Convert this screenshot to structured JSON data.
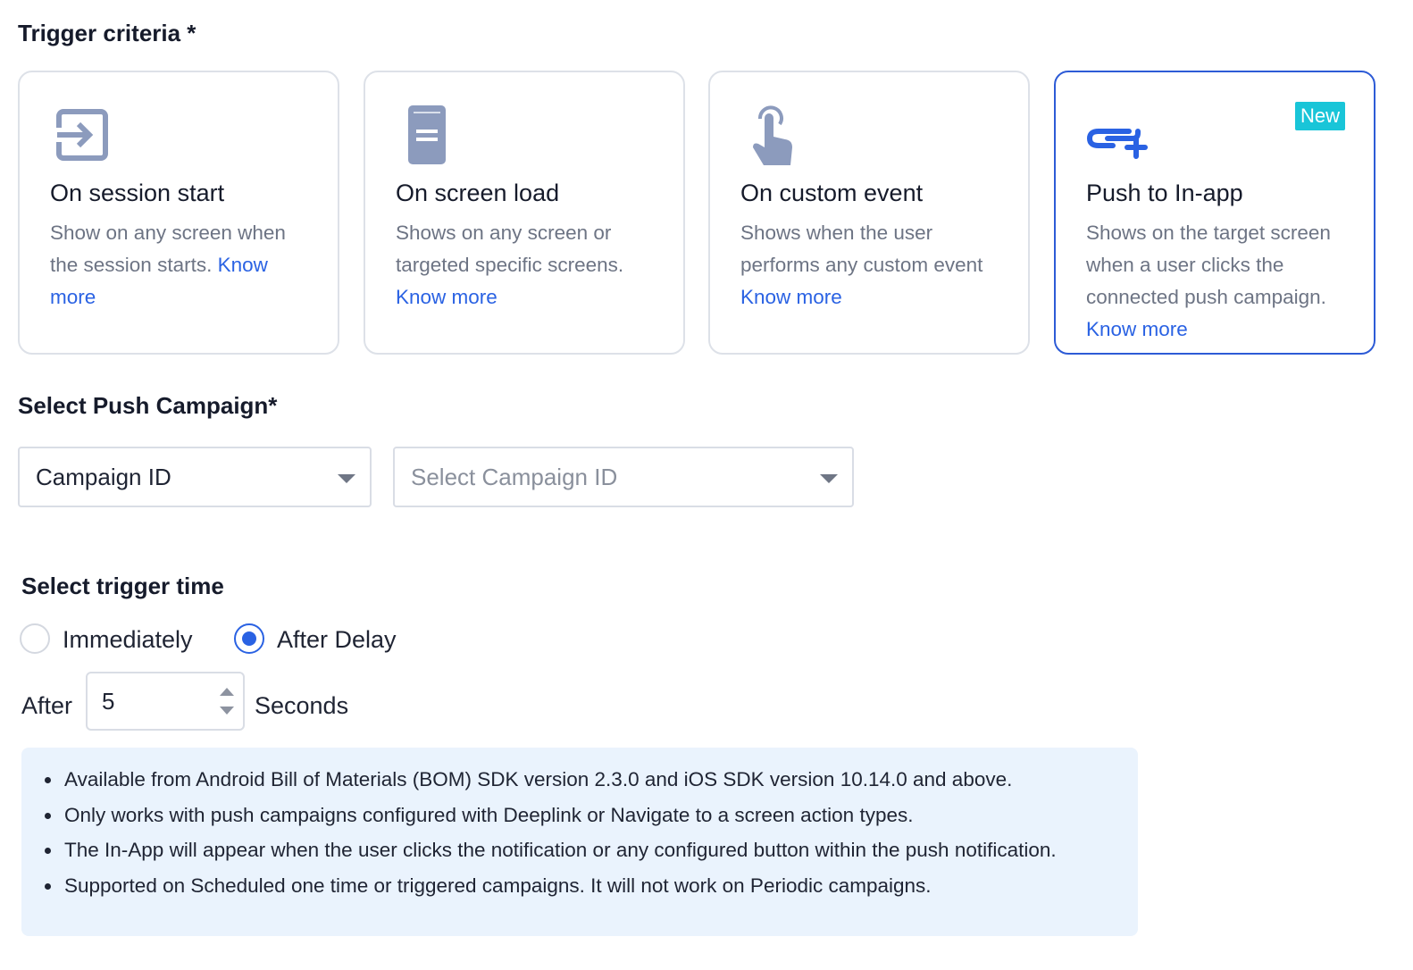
{
  "trigger_criteria": {
    "heading": "Trigger criteria *",
    "cards": [
      {
        "icon": "session-start-icon",
        "title": "On session start",
        "desc": "Show on any screen when the session starts.",
        "link": "Know more",
        "selected": false
      },
      {
        "icon": "screen-load-icon",
        "title": "On screen load",
        "desc": "Shows on any screen or targeted specific screens.",
        "link": "Know more",
        "selected": false
      },
      {
        "icon": "touch-icon",
        "title": "On custom event",
        "desc": "Shows when the user performs any custom event",
        "link": "Know more",
        "selected": false
      },
      {
        "icon": "push-link-icon",
        "title": "Push to In-app",
        "desc": "Shows on the target screen when a user clicks the connected push campaign.",
        "link": "Know more",
        "badge": "New",
        "selected": true
      }
    ]
  },
  "push_campaign": {
    "heading": "Select Push Campaign*",
    "type_select": {
      "value": "Campaign ID"
    },
    "id_select": {
      "placeholder": "Select Campaign ID"
    }
  },
  "trigger_time": {
    "heading": "Select trigger time",
    "options": [
      {
        "label": "Immediately",
        "checked": false
      },
      {
        "label": "After Delay",
        "checked": true
      }
    ],
    "delay": {
      "prefix": "After",
      "value": "5",
      "suffix": "Seconds"
    }
  },
  "notes": [
    "Available from Android Bill of Materials (BOM) SDK version 2.3.0 and iOS SDK version 10.14.0 and above.",
    "Only works with push campaigns configured with Deeplink or Navigate to a screen action types.",
    "The In-App will appear when the user clicks the notification or any configured button within the push notification.",
    "Supported on Scheduled one time or triggered campaigns. It will not work on Periodic campaigns."
  ],
  "colors": {
    "accent": "#2a62e3",
    "selected_border": "#2d5bd6",
    "badge": "#19c5d8",
    "icon_gray": "#8c9bbd",
    "info_bg": "#eaf3fd"
  }
}
